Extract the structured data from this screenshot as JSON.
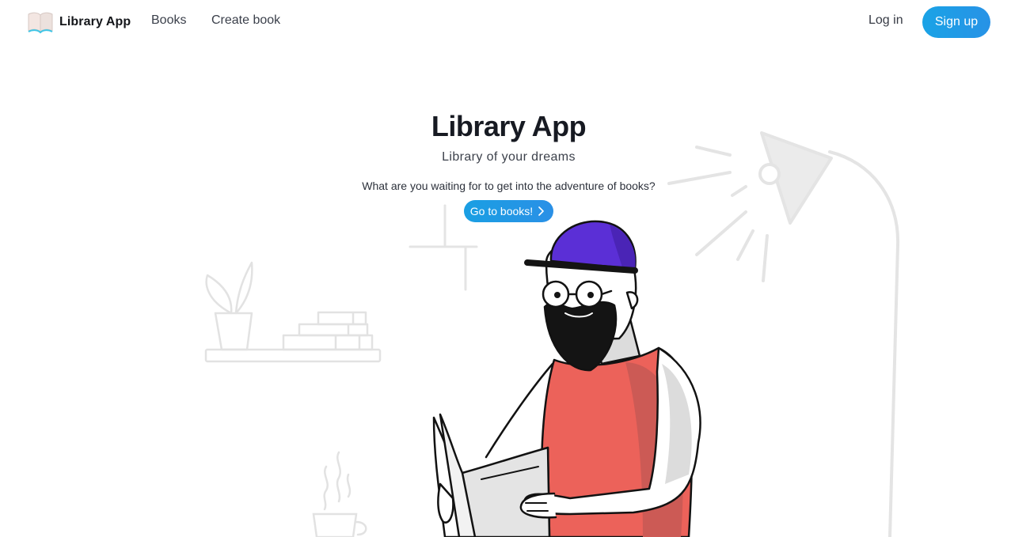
{
  "navbar": {
    "brand_name": "Library App",
    "brand_icon": "open-book-icon",
    "links": {
      "books": "Books",
      "create_book": "Create book"
    },
    "login_label": "Log in",
    "signup_label": "Sign up"
  },
  "hero": {
    "title": "Library App",
    "subtitle": "Library of your dreams",
    "text": "What are you waiting for to get into the adventure of books?",
    "cta_label": "Go to books!",
    "cta_icon": "chevron-right-icon"
  },
  "colors": {
    "accent": "#1e9be6",
    "cap": "#5b2fd6",
    "shirt": "#ec625a"
  }
}
